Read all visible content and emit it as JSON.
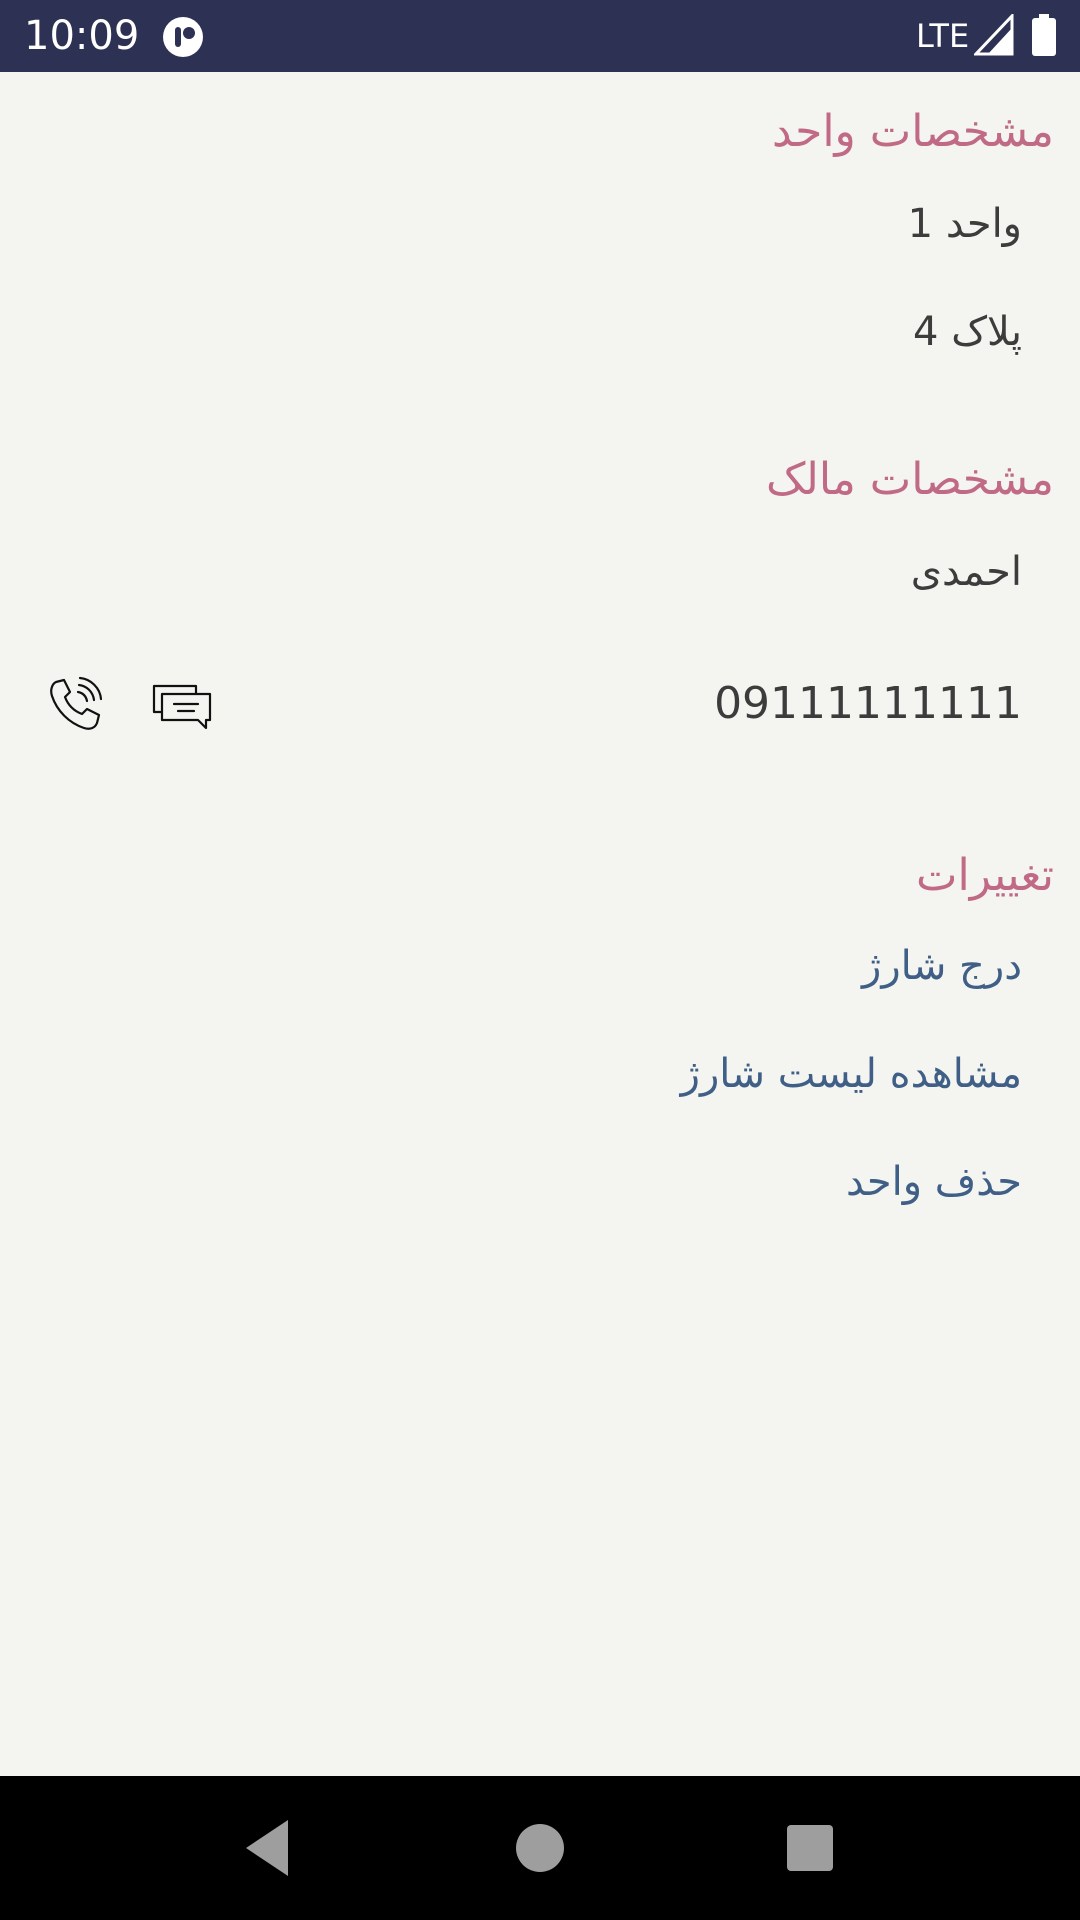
{
  "status_bar": {
    "time": "10:09",
    "network": "LTE",
    "bg_color": "#2d3154",
    "icons": [
      "app-notification-icon",
      "signal-icon",
      "battery-icon"
    ]
  },
  "unit_section": {
    "title": "مشخصات واحد",
    "unit_name": "واحد 1",
    "plate": "پلاک 4"
  },
  "owner_section": {
    "title": "مشخصات مالک",
    "owner_name": "احمدی",
    "phone": "09111111111",
    "actions": [
      "message-icon",
      "call-icon"
    ]
  },
  "changes_section": {
    "title": "تغییرات",
    "links": [
      {
        "label": "درج شارژ"
      },
      {
        "label": "مشاهده لیست شارژ"
      },
      {
        "label": "حذف واحد"
      }
    ]
  },
  "nav_bar": {
    "buttons": [
      "back-icon",
      "home-icon",
      "recents-icon"
    ]
  },
  "colors": {
    "background": "#f4f4f1",
    "section_title": "#c06a86",
    "link": "#3f5f86",
    "text": "#3c3c3c"
  }
}
